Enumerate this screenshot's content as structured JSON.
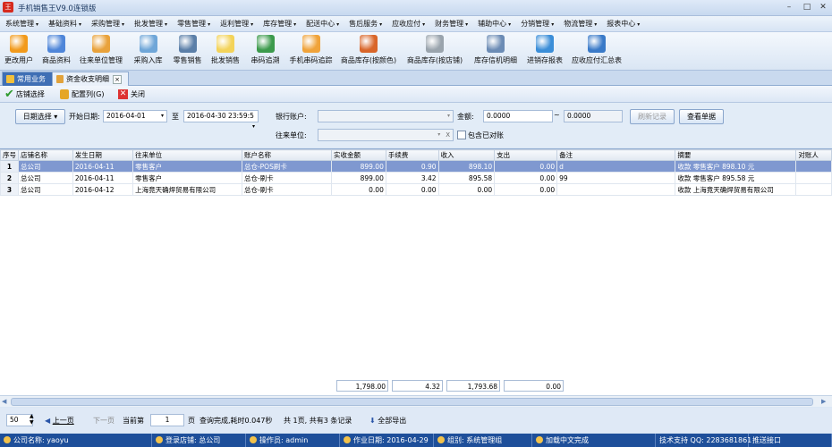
{
  "app": {
    "title": "手机销售王V9.0连锁版",
    "logo_text": "王"
  },
  "menu": [
    "系统管理",
    "基础资料",
    "采购管理",
    "批发管理",
    "零售管理",
    "返利管理",
    "库存管理",
    "配送中心",
    "售后服务",
    "应收应付",
    "财务管理",
    "辅助中心",
    "分销管理",
    "物流管理",
    "报表中心"
  ],
  "toolbar": [
    {
      "label": "更改用户",
      "icon": "rss-icon",
      "color": "#f29a1b"
    },
    {
      "label": "商品资料",
      "icon": "bar-chart-icon",
      "color": "#4f86d9"
    },
    {
      "label": "往来单位管理",
      "icon": "pie-chart-icon",
      "color": "#e9a23b"
    },
    {
      "label": "采购入库",
      "icon": "stack-icon",
      "color": "#6fa6d8"
    },
    {
      "label": "零售销售",
      "icon": "monitor-icon",
      "color": "#5b7fa8"
    },
    {
      "label": "批发销售",
      "icon": "note-icon",
      "color": "#f3d35a"
    },
    {
      "label": "串码追溯",
      "icon": "refresh-icon",
      "color": "#3c9a4c"
    },
    {
      "label": "手机串码追踪",
      "icon": "shield-icon",
      "color": "#f0a33a"
    },
    {
      "label": "商品库存(按颜色)",
      "icon": "box-icon",
      "color": "#d9662a"
    },
    {
      "label": "商品库存(按店铺)",
      "icon": "gear-icon",
      "color": "#9aa4ad"
    },
    {
      "label": "库存信机明细",
      "icon": "magnifier-icon",
      "color": "#6c8cb5"
    },
    {
      "label": "进销存报表",
      "icon": "globe-icon",
      "color": "#3b8ed8"
    },
    {
      "label": "应收应付汇总表",
      "icon": "screen-icon",
      "color": "#3a7ac8"
    }
  ],
  "tabs": {
    "home": "常用业务",
    "active": "资金收支明细",
    "close": "×"
  },
  "actions": {
    "store_select": "店铺选择",
    "config_columns": "配置列(G)",
    "close": "关闭"
  },
  "filters": {
    "date_mode": "日期选择",
    "start_label": "开始日期:",
    "start_value": "2016-04-01",
    "to_label": "至",
    "end_value": "2016-04-30 23:59:5",
    "bank_label": "银行账户:",
    "bank_value": "",
    "amount_label": "金额:",
    "amount_from": "0.0000",
    "tilde": "~",
    "amount_to": "0.0000",
    "refresh_label": "刷新记录",
    "query_label": "查看单据",
    "partner_label": "往来单位:",
    "partner_value": "",
    "partner_clear": "X",
    "reconciled_label": "包含已对账"
  },
  "grid": {
    "headers": [
      "序号",
      "店铺名称",
      "发生日期",
      "往来单位",
      "账户名称",
      "实收金额",
      "手续费",
      "收入",
      "支出",
      "备注",
      "摘要",
      "对账人"
    ],
    "rows": [
      {
        "no": "1",
        "store": "总公司",
        "date": "2016-04-11",
        "partner": "零售客户",
        "account": "总仓-POS刷卡",
        "received": "899.00",
        "fee": "0.90",
        "income": "898.10",
        "expense": "0.00",
        "note": "d",
        "summary": "收款 零售客户 898.10 元",
        "checker": ""
      },
      {
        "no": "2",
        "store": "总公司",
        "date": "2016-04-11",
        "partner": "零售客户",
        "account": "总仓-刷卡",
        "received": "899.00",
        "fee": "3.42",
        "income": "895.58",
        "expense": "0.00",
        "note": "99",
        "summary": "收款 零售客户 895.58 元",
        "checker": ""
      },
      {
        "no": "3",
        "store": "总公司",
        "date": "2016-04-12",
        "partner": "上海竟天确焊贸易有限公司",
        "account": "总仓-刷卡",
        "received": "0.00",
        "fee": "0.00",
        "income": "0.00",
        "expense": "0.00",
        "note": "",
        "summary": "收款 上海竟天确焊贸易有限公司",
        "checker": ""
      }
    ]
  },
  "totals": {
    "received": "1,798.00",
    "fee": "4.32",
    "income": "1,793.68",
    "expense": "0.00"
  },
  "pager": {
    "page_size": "50",
    "prev": "上一页",
    "next": "下一页",
    "current_label": "当前第",
    "current_page": "1",
    "page_unit": "页",
    "info": "查询完成,耗时0.047秒",
    "summary": "共 1页, 共有3 条记录",
    "export": "全部导出"
  },
  "status": [
    "公司名称: yaoyu",
    "登录店铺: 总公司",
    "操作员: admin",
    "作业日期: 2016-04-29",
    "组别: 系统管理组",
    "加载中文完成",
    "技术支持 QQ: 2283681861",
    "推送接口"
  ]
}
